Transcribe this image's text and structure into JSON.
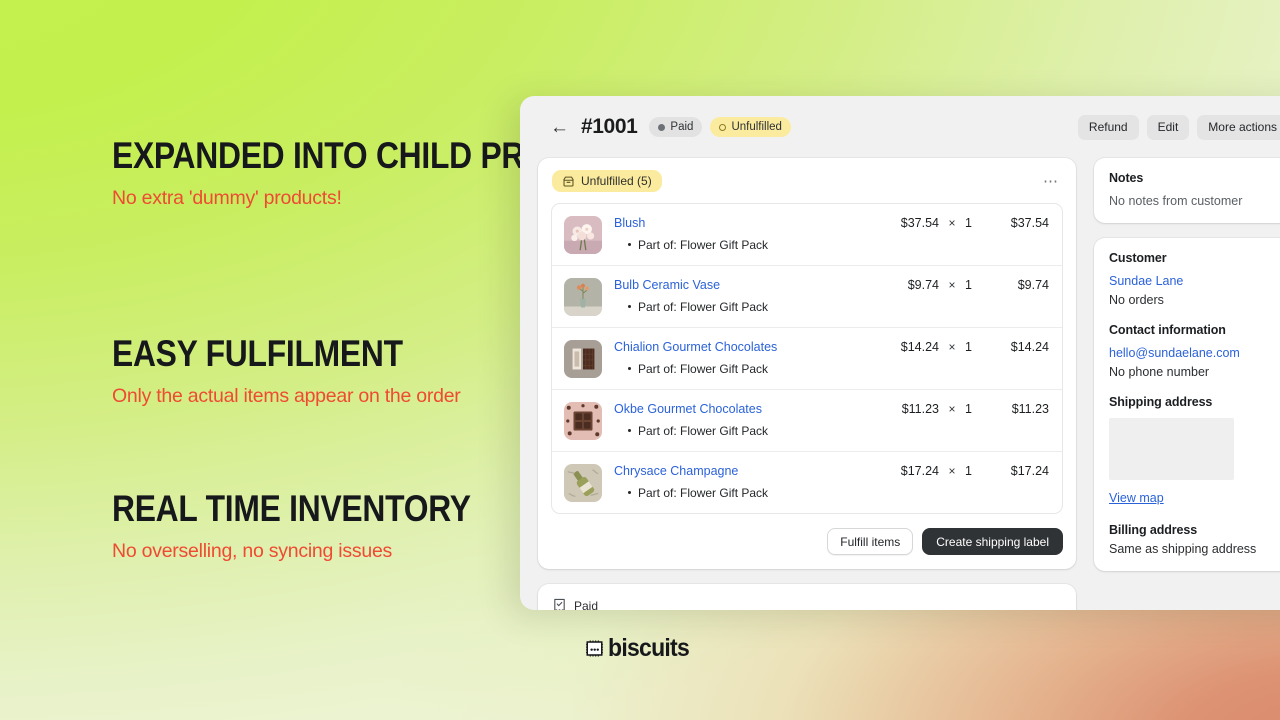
{
  "theme": {
    "lime": "#c6f24f",
    "salmon": "#db8a6b",
    "accent_red": "#ef4a32",
    "link_blue": "#2b62d9",
    "badge_yellow": "#fbeb9f",
    "dark_button": "#303336"
  },
  "marketing": {
    "blocks": [
      {
        "heading": "EXPANDED INTO CHILD PRODUCTS",
        "subheading": "No extra 'dummy' products!"
      },
      {
        "heading": "EASY FULFILMENT",
        "subheading": "Only the actual items appear on the order"
      },
      {
        "heading": "REAL TIME INVENTORY",
        "subheading": "No overselling, no syncing issues"
      }
    ]
  },
  "app": {
    "header": {
      "back_icon": "arrow-left-icon",
      "order_number": "#1001",
      "payment_status": "Paid",
      "fulfillment_status": "Unfulfilled",
      "actions": {
        "refund": "Refund",
        "edit": "Edit",
        "more": "More actions"
      }
    },
    "fulfillment_card": {
      "badge_icon": "package-icon",
      "badge_label": "Unfulfilled (5)",
      "kebab_icon": "more-horizontal-icon",
      "items": [
        {
          "name": "Blush",
          "part_of": "Part of: Flower Gift Pack",
          "price": "$37.54",
          "multiplier": "×",
          "quantity": "1",
          "total": "$37.54",
          "thumb": "bouquet-pink"
        },
        {
          "name": "Bulb Ceramic Vase",
          "part_of": "Part of: Flower Gift Pack",
          "price": "$9.74",
          "multiplier": "×",
          "quantity": "1",
          "total": "$9.74",
          "thumb": "vase-green"
        },
        {
          "name": "Chialion Gourmet Chocolates",
          "part_of": "Part of: Flower Gift Pack",
          "price": "$14.24",
          "multiplier": "×",
          "quantity": "1",
          "total": "$14.24",
          "thumb": "chocolate-bar"
        },
        {
          "name": "Okbe Gourmet Chocolates",
          "part_of": "Part of: Flower Gift Pack",
          "price": "$11.23",
          "multiplier": "×",
          "quantity": "1",
          "total": "$11.23",
          "thumb": "chocolate-box"
        },
        {
          "name": "Chrysace Champagne",
          "part_of": "Part of: Flower Gift Pack",
          "price": "$17.24",
          "multiplier": "×",
          "quantity": "1",
          "total": "$17.24",
          "thumb": "champagne-bottle"
        }
      ],
      "buttons": {
        "fulfill": "Fulfill items",
        "shipping_label": "Create shipping label"
      }
    },
    "paid_card": {
      "icon": "receipt-icon",
      "label": "Paid"
    },
    "sidebar": {
      "notes": {
        "title": "Notes",
        "body": "No notes from customer"
      },
      "customer": {
        "title": "Customer",
        "name": "Sundae Lane",
        "orders": "No orders",
        "contact_title": "Contact information",
        "email": "hello@sundaelane.com",
        "phone": "No phone number",
        "shipping_title": "Shipping address",
        "view_map": "View map",
        "billing_title": "Billing address",
        "billing_value": "Same as shipping address"
      }
    }
  },
  "brand": {
    "mark": "biscuit-icon",
    "name": "biscuits"
  }
}
